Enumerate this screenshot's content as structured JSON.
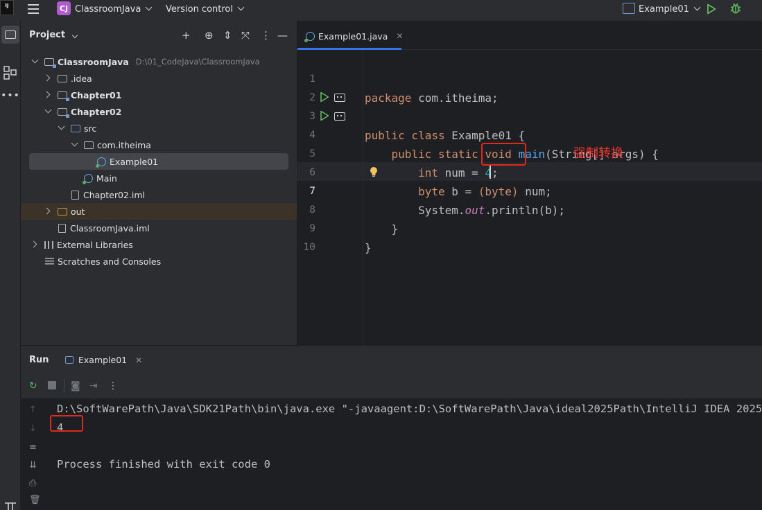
{
  "titlebar": {
    "logo_text": "IJ",
    "project_badge": "CJ",
    "project_name": "ClassroomJava",
    "version_control": "Version control",
    "run_config": "Example01"
  },
  "project_panel": {
    "title": "Project",
    "tree": [
      {
        "label": "ClassroomJava",
        "path": "D:\\01_CodeJava\\ClassroomJava"
      },
      {
        "label": ".idea"
      },
      {
        "label": "Chapter01"
      },
      {
        "label": "Chapter02"
      },
      {
        "label": "src"
      },
      {
        "label": "com.itheima"
      },
      {
        "label": "Example01"
      },
      {
        "label": "Main"
      },
      {
        "label": "Chapter02.iml"
      },
      {
        "label": "out"
      },
      {
        "label": "ClassroomJava.iml"
      },
      {
        "label": "External Libraries"
      },
      {
        "label": "Scratches and Consoles"
      }
    ]
  },
  "editor": {
    "tab_label": "Example01.java",
    "line_numbers": [
      "1",
      "2",
      "3",
      "4",
      "5",
      "6",
      "7",
      "8",
      "9",
      "10"
    ],
    "annotation": "强制转换",
    "code": {
      "l1_kw": "package",
      "l1_rest": " com.itheima;",
      "l3_kw": "public class",
      "l3_rest": " Example01 {",
      "l4_kw": "public static void",
      "l4_fn": "main",
      "l4_rest": "(String[] args) {",
      "l5_kw": "int",
      "l5_a": " num = ",
      "l5_num": "4",
      "l5_b": ";",
      "l6_kw": "byte",
      "l6_a": " b = ",
      "l6_cast": "(byte)",
      "l6_b": " num;",
      "l7_a": "System.",
      "l7_fld": "out",
      "l7_b": ".println(b);",
      "l8": "}",
      "l9": "}"
    }
  },
  "run_panel": {
    "label": "Run",
    "tab_label": "Example01",
    "console_lines": [
      "D:\\SoftWarePath\\Java\\SDK21Path\\bin\\java.exe \"-javaagent:D:\\SoftWarePath\\Java\\ideal2025Path\\IntelliJ IDEA 2025",
      "4",
      "",
      "Process finished with exit code 0"
    ]
  },
  "colors": {
    "accent": "#3574f0",
    "keyword": "#cf8e6d",
    "function": "#56a8f5",
    "number": "#2aacb8",
    "annotation_red": "#e8332a"
  }
}
